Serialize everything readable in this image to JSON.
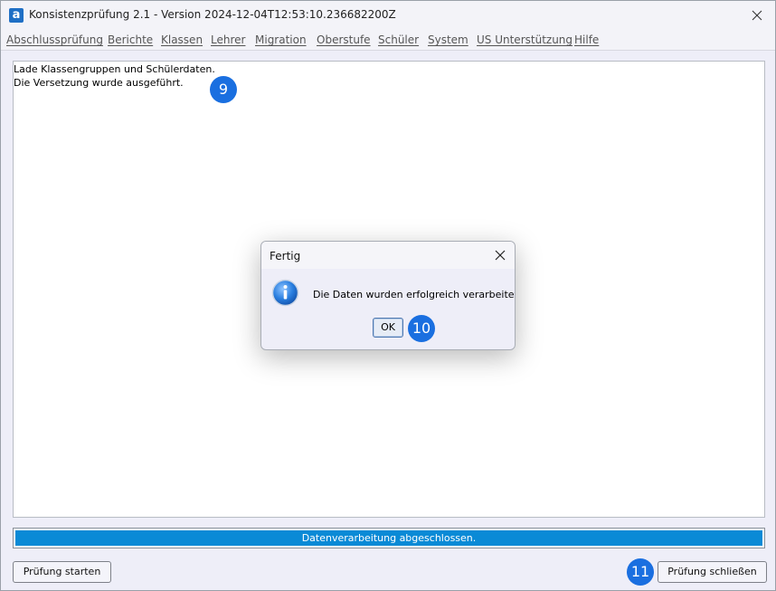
{
  "window": {
    "title": "Konsistenzprüfung 2.1 - Version 2024-12-04T12:53:10.236682200Z",
    "icon_letter": "a",
    "icon": "app-logo-icon",
    "close_icon": "close-icon"
  },
  "menu": {
    "items": [
      {
        "label": "Abschlussprüfung"
      },
      {
        "label": "Berichte"
      },
      {
        "label": "Klassen"
      },
      {
        "label": "Lehrer"
      },
      {
        "label": "Migration"
      },
      {
        "label": "Oberstufe"
      },
      {
        "label": "Schüler"
      },
      {
        "label": "System"
      },
      {
        "label": "US Unterstützung"
      },
      {
        "label": "Hilfe"
      }
    ]
  },
  "log": {
    "lines": [
      "Lade Klassengruppen und Schülerdaten.",
      "Die Versetzung wurde ausgeführt."
    ]
  },
  "badges": {
    "step_9": "9",
    "step_10": "10",
    "step_11": "11",
    "color": "#1a6fe0"
  },
  "progress": {
    "label": "Datenverarbeitung abgeschlossen.",
    "percent": 100,
    "color": "#0a8ad6"
  },
  "buttons": {
    "start": "Prüfung starten",
    "close": "Prüfung schließen"
  },
  "dialog": {
    "title": "Fertig",
    "message": "Die Daten wurden erfolgreich verarbeitet.",
    "ok_label": "OK",
    "icon": "info-icon",
    "close_icon": "close-icon"
  }
}
